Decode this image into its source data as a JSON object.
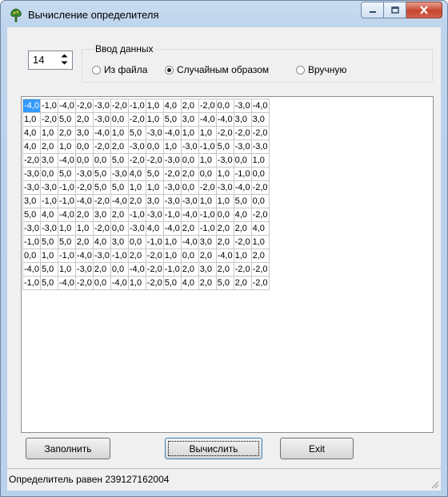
{
  "window": {
    "title": "Вычисление определителя"
  },
  "size_spinner": {
    "value": "14"
  },
  "input_group": {
    "title": "Ввод данных",
    "options": [
      {
        "label": "Из файла",
        "checked": false
      },
      {
        "label": "Случайным образом",
        "checked": true
      },
      {
        "label": "Вручную",
        "checked": false
      }
    ]
  },
  "matrix": {
    "rows": [
      [
        "-4,0",
        "-1,0",
        "-4,0",
        "-2,0",
        "-3,0",
        "-2,0",
        "-1,0",
        "1,0",
        "4,0",
        "2,0",
        "-2,0",
        "0,0",
        "-3,0",
        "-4,0"
      ],
      [
        "1,0",
        "-2,0",
        "5,0",
        "2,0",
        "-3,0",
        "0,0",
        "-2,0",
        "1,0",
        "5,0",
        "3,0",
        "-4,0",
        "-4,0",
        "3,0",
        "3,0"
      ],
      [
        "4,0",
        "1,0",
        "2,0",
        "3,0",
        "-4,0",
        "1,0",
        "5,0",
        "-3,0",
        "-4,0",
        "1,0",
        "1,0",
        "-2,0",
        "-2,0",
        "-2,0"
      ],
      [
        "4,0",
        "2,0",
        "1,0",
        "0,0",
        "-2,0",
        "2,0",
        "-3,0",
        "0,0",
        "1,0",
        "-3,0",
        "-1,0",
        "5,0",
        "-3,0",
        "-3,0"
      ],
      [
        "-2,0",
        "3,0",
        "-4,0",
        "0,0",
        "0,0",
        "5,0",
        "-2,0",
        "-2,0",
        "-3,0",
        "0,0",
        "1,0",
        "-3,0",
        "0,0",
        "1,0"
      ],
      [
        "-3,0",
        "0,0",
        "5,0",
        "-3,0",
        "5,0",
        "-3,0",
        "4,0",
        "5,0",
        "-2,0",
        "2,0",
        "0,0",
        "1,0",
        "-1,0",
        "0,0"
      ],
      [
        "-3,0",
        "-3,0",
        "-1,0",
        "-2,0",
        "5,0",
        "5,0",
        "1,0",
        "1,0",
        "-3,0",
        "0,0",
        "-2,0",
        "-3,0",
        "-4,0",
        "-2,0"
      ],
      [
        "3,0",
        "-1,0",
        "-1,0",
        "-4,0",
        "-2,0",
        "-4,0",
        "2,0",
        "3,0",
        "-3,0",
        "-3,0",
        "1,0",
        "1,0",
        "5,0",
        "0,0"
      ],
      [
        "5,0",
        "4,0",
        "-4,0",
        "2,0",
        "3,0",
        "2,0",
        "-1,0",
        "-3,0",
        "-1,0",
        "-4,0",
        "-1,0",
        "0,0",
        "4,0",
        "-2,0"
      ],
      [
        "-3,0",
        "-3,0",
        "1,0",
        "1,0",
        "-2,0",
        "0,0",
        "-3,0",
        "4,0",
        "-4,0",
        "2,0",
        "-1,0",
        "2,0",
        "2,0",
        "4,0"
      ],
      [
        "-1,0",
        "5,0",
        "5,0",
        "2,0",
        "4,0",
        "3,0",
        "0,0",
        "-1,0",
        "1,0",
        "-4,0",
        "3,0",
        "2,0",
        "-2,0",
        "1,0"
      ],
      [
        "0,0",
        "1,0",
        "-1,0",
        "-4,0",
        "-3,0",
        "-1,0",
        "2,0",
        "-2,0",
        "1,0",
        "0,0",
        "2,0",
        "-4,0",
        "1,0",
        "2,0"
      ],
      [
        "-4,0",
        "5,0",
        "1,0",
        "-3,0",
        "2,0",
        "0,0",
        "-4,0",
        "-2,0",
        "-1,0",
        "2,0",
        "3,0",
        "2,0",
        "-2,0",
        "-2,0"
      ],
      [
        "-1,0",
        "5,0",
        "-4,0",
        "-2,0",
        "0,0",
        "-4,0",
        "1,0",
        "-2,0",
        "5,0",
        "4,0",
        "2,0",
        "5,0",
        "2,0",
        "-2,0"
      ]
    ]
  },
  "buttons": {
    "fill": "Заполнить",
    "compute": "Вычислить",
    "exit": "Exit"
  },
  "status": {
    "text": "Определитель равен 239127162004"
  },
  "colors": {
    "selection": "#3399ff",
    "close_button": "#c6452f",
    "window_frame": "#bcd3ec"
  }
}
